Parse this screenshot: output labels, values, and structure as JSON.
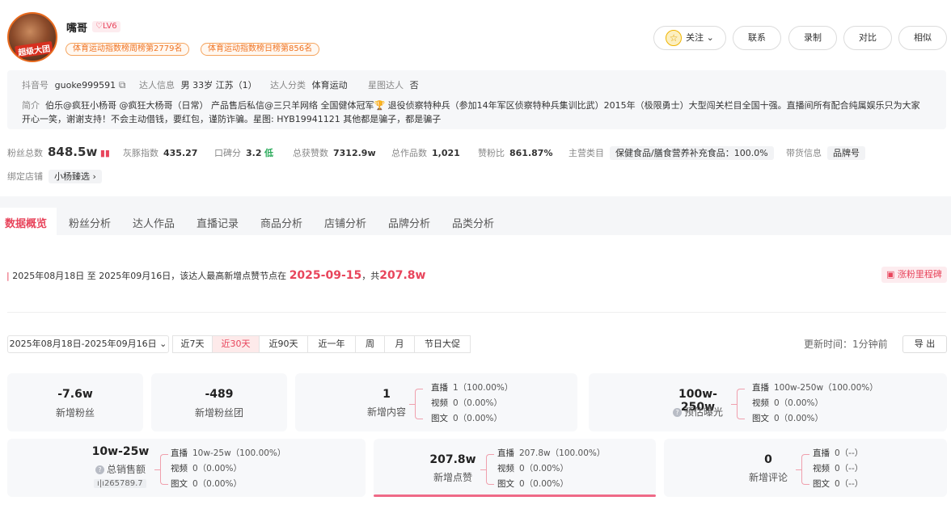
{
  "profile": {
    "name": "嘴哥",
    "level": "LV6",
    "avatar_badge": "超级大团",
    "rank_weekly": "体育运动指数榜周榜第2779名",
    "rank_daily": "体育运动指数榜日榜第856名"
  },
  "actions": {
    "follow": "关注",
    "contact": "联系",
    "record": "录制",
    "compare": "对比",
    "similar": "相似"
  },
  "info": {
    "douyin_label": "抖音号",
    "douyin_value": "guoke999591",
    "talent_label": "达人信息",
    "talent_value": "男 33岁 江苏（1）",
    "category_label": "达人分类",
    "category_value": "体育运动",
    "star_label": "星图达人",
    "star_value": "否",
    "bio_label": "简介",
    "bio_text": "伯乐@疯狂小杨哥 @疯狂大杨哥（日常） 产品售后私信@三只羊网络 全国健体冠军🏆 退役侦察特种兵（参加14年军区侦察特种兵集训比武）2015年（极限勇士）大型闯关栏目全国十强。直播间所有配合纯属娱乐只为大家开心一笑，谢谢支持！不会主动借钱，要红包，谨防诈骗。星图: HYB19941121 其他都是骗子，都是骗子"
  },
  "stats": {
    "fans_label": "粉丝总数",
    "fans_value": "848.5w",
    "gray_label": "灰豚指数",
    "gray_value": "435.27",
    "rep_label": "口碑分",
    "rep_value": "3.2",
    "rep_level": "低",
    "likes_label": "总获赞数",
    "likes_value": "7312.9w",
    "works_label": "总作品数",
    "works_value": "1,021",
    "ratio_label": "赞粉比",
    "ratio_value": "861.87%",
    "main_label": "主营类目",
    "main_value": "保健食品/膳食营养补充食品：100.0%",
    "goods_label": "带货信息",
    "goods_value": "品牌号",
    "shop_label": "绑定店铺",
    "shop_value": "小杨臻选"
  },
  "tabs": [
    "数据概览",
    "粉丝分析",
    "达人作品",
    "直播记录",
    "商品分析",
    "店铺分析",
    "品牌分析",
    "品类分析"
  ],
  "notice": {
    "prefix": "2025年08月18日 至 2025年09月16日，该达人最高新增点赞节点在",
    "date": "2025-09-15",
    "mid": "，共",
    "amount": "207.8w",
    "milestone": "涨粉里程碑"
  },
  "filters": {
    "range": "2025年08月18日-2025年09月16日",
    "opts": [
      "近7天",
      "近30天",
      "近90天",
      "近一年",
      "周",
      "月",
      "节日大促"
    ],
    "active": "近30天",
    "updated": "更新时间：1分钟前",
    "export": "导 出"
  },
  "cards": {
    "fans": {
      "value": "-7.6w",
      "label": "新增粉丝"
    },
    "club": {
      "value": "-489",
      "label": "新增粉丝团"
    },
    "content": {
      "value": "1",
      "label": "新增内容",
      "rows": [
        [
          "直播",
          "1（100.00%）"
        ],
        [
          "视频",
          "0（0.00%）"
        ],
        [
          "图文",
          "0（0.00%）"
        ]
      ]
    },
    "exposure": {
      "value": "100w-250w",
      "label": "预估曝光",
      "rows": [
        [
          "直播",
          "100w-250w（100.00%）"
        ],
        [
          "视频",
          "0（0.00%）"
        ],
        [
          "图文",
          "0（0.00%）"
        ]
      ]
    },
    "sales": {
      "value": "10w-25w",
      "label": "总销售额",
      "sub": "265789.7",
      "rows": [
        [
          "直播",
          "10w-25w（100.00%）"
        ],
        [
          "视频",
          "0（0.00%）"
        ],
        [
          "图文",
          "0（0.00%）"
        ]
      ]
    },
    "likes": {
      "value": "207.8w",
      "label": "新增点赞",
      "rows": [
        [
          "直播",
          "207.8w（100.00%）"
        ],
        [
          "视频",
          "0（0.00%）"
        ],
        [
          "图文",
          "0（0.00%）"
        ]
      ]
    },
    "comments": {
      "value": "0",
      "label": "新增评论",
      "rows": [
        [
          "直播",
          "0（--）"
        ],
        [
          "视频",
          "0（--）"
        ],
        [
          "图文",
          "0（--）"
        ]
      ]
    }
  },
  "colors": {
    "accent": "#e8455c",
    "orange": "#f07423",
    "green": "#2aaa5a"
  }
}
